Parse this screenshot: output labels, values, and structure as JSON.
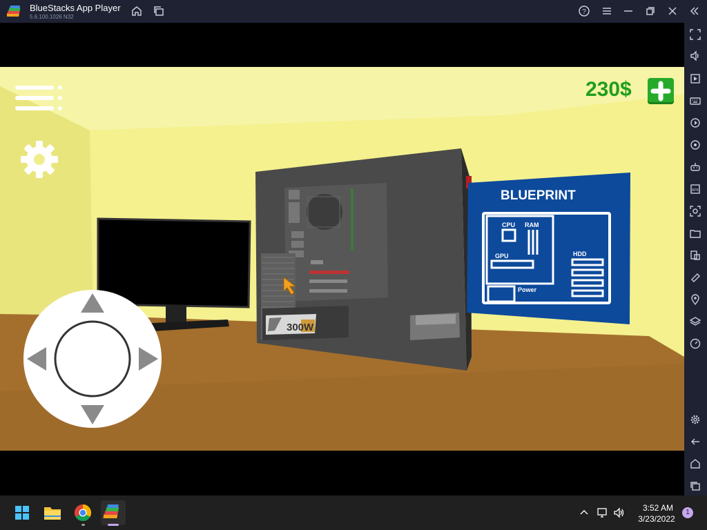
{
  "window": {
    "title": "BlueStacks App Player",
    "version": "5.6.100.1026 N32"
  },
  "titlebar_icons": [
    "home-icon",
    "multi-instance-icon",
    "help-icon",
    "menu-icon",
    "minimize-icon",
    "restore-icon",
    "close-icon",
    "collapse-sidebar-icon"
  ],
  "sidebar_icons": [
    "fullscreen-icon",
    "volume-icon",
    "media-icon",
    "keyboard-controls-icon",
    "macro-icon",
    "sync-icon",
    "gamepad-icon",
    "apk-icon",
    "screenshot-icon",
    "folder-icon",
    "multi-window-icon",
    "eco-mode-icon",
    "location-icon",
    "layers-icon",
    "performance-icon",
    "settings-icon",
    "back-icon",
    "home-icon",
    "recent-apps-icon"
  ],
  "game": {
    "money": "230$",
    "blueprint": {
      "title": "BLUEPRINT",
      "labels": {
        "cpu": "CPU",
        "ram": "RAM",
        "gpu": "GPU",
        "hdd": "HDD",
        "power": "Power"
      }
    },
    "psu_label": "300W",
    "colors": {
      "wall": "#f3f08c",
      "floor": "#a46f2d",
      "blueprint": "#0d4a9c",
      "money": "#1f9e1f",
      "add_button": "#27a92a"
    }
  },
  "taskbar": {
    "apps": [
      "start-icon",
      "file-explorer-icon",
      "chrome-icon",
      "bluestacks-icon"
    ],
    "time": "3:52 AM",
    "date": "3/23/2022",
    "notification_count": "1"
  }
}
